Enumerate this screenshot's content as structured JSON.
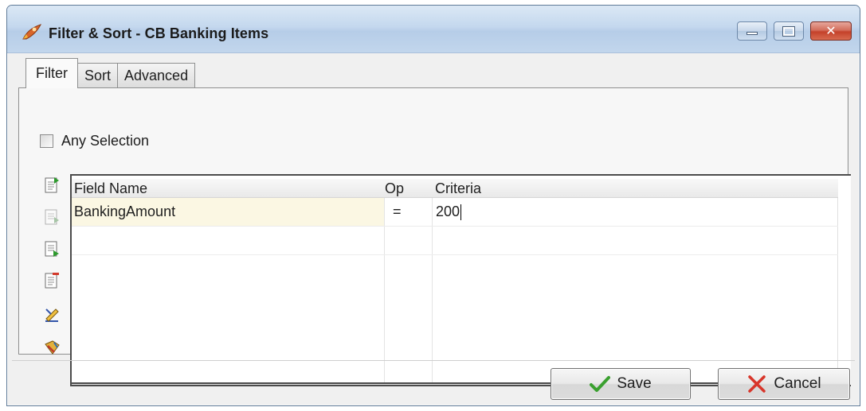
{
  "window": {
    "title": "Filter & Sort - CB Banking Items",
    "app_icon": "rocket-icon",
    "controls": [
      "minimize",
      "maximize",
      "close"
    ]
  },
  "tabs": [
    {
      "label": "Filter",
      "active": true
    },
    {
      "label": "Sort",
      "active": false
    },
    {
      "label": "Advanced",
      "active": false
    }
  ],
  "filter": {
    "any_selection_label": "Any Selection",
    "any_selection_checked": false,
    "toolbar_icons": [
      "add-row-icon",
      "insert-row-icon",
      "append-row-icon",
      "delete-row-icon",
      "edit-criteria-icon",
      "clear-filter-icon"
    ],
    "grid": {
      "columns": [
        "Field Name",
        "Op",
        "Criteria"
      ],
      "rows": [
        {
          "field": "BankingAmount",
          "op": "=",
          "criteria": "200"
        }
      ]
    }
  },
  "buttons": {
    "save_label": "Save",
    "cancel_label": "Cancel"
  },
  "colors": {
    "selected_row": "#fbf7e3",
    "save_icon": "#3aa02f",
    "cancel_icon": "#d8352a"
  }
}
